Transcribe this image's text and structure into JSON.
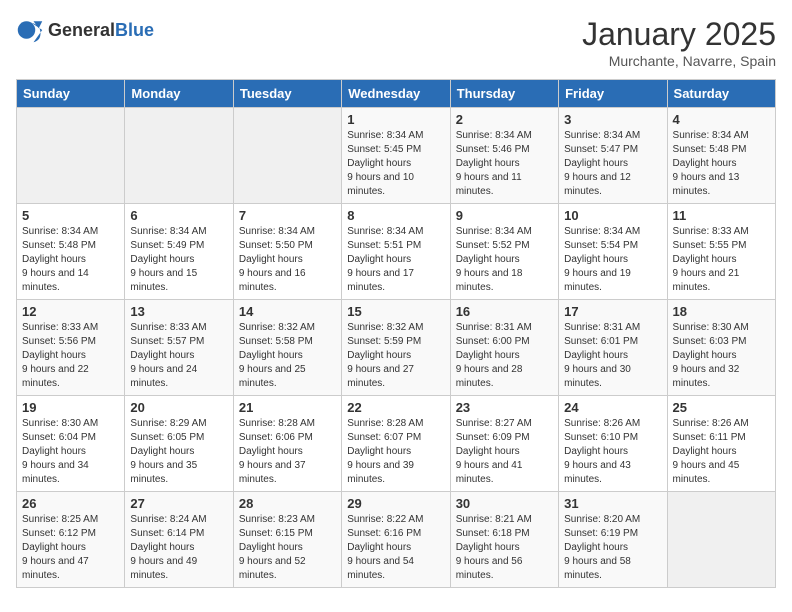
{
  "header": {
    "logo_general": "General",
    "logo_blue": "Blue",
    "month_title": "January 2025",
    "location": "Murchante, Navarre, Spain"
  },
  "days_of_week": [
    "Sunday",
    "Monday",
    "Tuesday",
    "Wednesday",
    "Thursday",
    "Friday",
    "Saturday"
  ],
  "weeks": [
    [
      {
        "day": "",
        "empty": true
      },
      {
        "day": "",
        "empty": true
      },
      {
        "day": "",
        "empty": true
      },
      {
        "day": "1",
        "sunrise": "8:34 AM",
        "sunset": "5:45 PM",
        "daylight": "9 hours and 10 minutes."
      },
      {
        "day": "2",
        "sunrise": "8:34 AM",
        "sunset": "5:46 PM",
        "daylight": "9 hours and 11 minutes."
      },
      {
        "day": "3",
        "sunrise": "8:34 AM",
        "sunset": "5:47 PM",
        "daylight": "9 hours and 12 minutes."
      },
      {
        "day": "4",
        "sunrise": "8:34 AM",
        "sunset": "5:48 PM",
        "daylight": "9 hours and 13 minutes."
      }
    ],
    [
      {
        "day": "5",
        "sunrise": "8:34 AM",
        "sunset": "5:48 PM",
        "daylight": "9 hours and 14 minutes."
      },
      {
        "day": "6",
        "sunrise": "8:34 AM",
        "sunset": "5:49 PM",
        "daylight": "9 hours and 15 minutes."
      },
      {
        "day": "7",
        "sunrise": "8:34 AM",
        "sunset": "5:50 PM",
        "daylight": "9 hours and 16 minutes."
      },
      {
        "day": "8",
        "sunrise": "8:34 AM",
        "sunset": "5:51 PM",
        "daylight": "9 hours and 17 minutes."
      },
      {
        "day": "9",
        "sunrise": "8:34 AM",
        "sunset": "5:52 PM",
        "daylight": "9 hours and 18 minutes."
      },
      {
        "day": "10",
        "sunrise": "8:34 AM",
        "sunset": "5:54 PM",
        "daylight": "9 hours and 19 minutes."
      },
      {
        "day": "11",
        "sunrise": "8:33 AM",
        "sunset": "5:55 PM",
        "daylight": "9 hours and 21 minutes."
      }
    ],
    [
      {
        "day": "12",
        "sunrise": "8:33 AM",
        "sunset": "5:56 PM",
        "daylight": "9 hours and 22 minutes."
      },
      {
        "day": "13",
        "sunrise": "8:33 AM",
        "sunset": "5:57 PM",
        "daylight": "9 hours and 24 minutes."
      },
      {
        "day": "14",
        "sunrise": "8:32 AM",
        "sunset": "5:58 PM",
        "daylight": "9 hours and 25 minutes."
      },
      {
        "day": "15",
        "sunrise": "8:32 AM",
        "sunset": "5:59 PM",
        "daylight": "9 hours and 27 minutes."
      },
      {
        "day": "16",
        "sunrise": "8:31 AM",
        "sunset": "6:00 PM",
        "daylight": "9 hours and 28 minutes."
      },
      {
        "day": "17",
        "sunrise": "8:31 AM",
        "sunset": "6:01 PM",
        "daylight": "9 hours and 30 minutes."
      },
      {
        "day": "18",
        "sunrise": "8:30 AM",
        "sunset": "6:03 PM",
        "daylight": "9 hours and 32 minutes."
      }
    ],
    [
      {
        "day": "19",
        "sunrise": "8:30 AM",
        "sunset": "6:04 PM",
        "daylight": "9 hours and 34 minutes."
      },
      {
        "day": "20",
        "sunrise": "8:29 AM",
        "sunset": "6:05 PM",
        "daylight": "9 hours and 35 minutes."
      },
      {
        "day": "21",
        "sunrise": "8:28 AM",
        "sunset": "6:06 PM",
        "daylight": "9 hours and 37 minutes."
      },
      {
        "day": "22",
        "sunrise": "8:28 AM",
        "sunset": "6:07 PM",
        "daylight": "9 hours and 39 minutes."
      },
      {
        "day": "23",
        "sunrise": "8:27 AM",
        "sunset": "6:09 PM",
        "daylight": "9 hours and 41 minutes."
      },
      {
        "day": "24",
        "sunrise": "8:26 AM",
        "sunset": "6:10 PM",
        "daylight": "9 hours and 43 minutes."
      },
      {
        "day": "25",
        "sunrise": "8:26 AM",
        "sunset": "6:11 PM",
        "daylight": "9 hours and 45 minutes."
      }
    ],
    [
      {
        "day": "26",
        "sunrise": "8:25 AM",
        "sunset": "6:12 PM",
        "daylight": "9 hours and 47 minutes."
      },
      {
        "day": "27",
        "sunrise": "8:24 AM",
        "sunset": "6:14 PM",
        "daylight": "9 hours and 49 minutes."
      },
      {
        "day": "28",
        "sunrise": "8:23 AM",
        "sunset": "6:15 PM",
        "daylight": "9 hours and 52 minutes."
      },
      {
        "day": "29",
        "sunrise": "8:22 AM",
        "sunset": "6:16 PM",
        "daylight": "9 hours and 54 minutes."
      },
      {
        "day": "30",
        "sunrise": "8:21 AM",
        "sunset": "6:18 PM",
        "daylight": "9 hours and 56 minutes."
      },
      {
        "day": "31",
        "sunrise": "8:20 AM",
        "sunset": "6:19 PM",
        "daylight": "9 hours and 58 minutes."
      },
      {
        "day": "",
        "empty": true
      }
    ]
  ]
}
